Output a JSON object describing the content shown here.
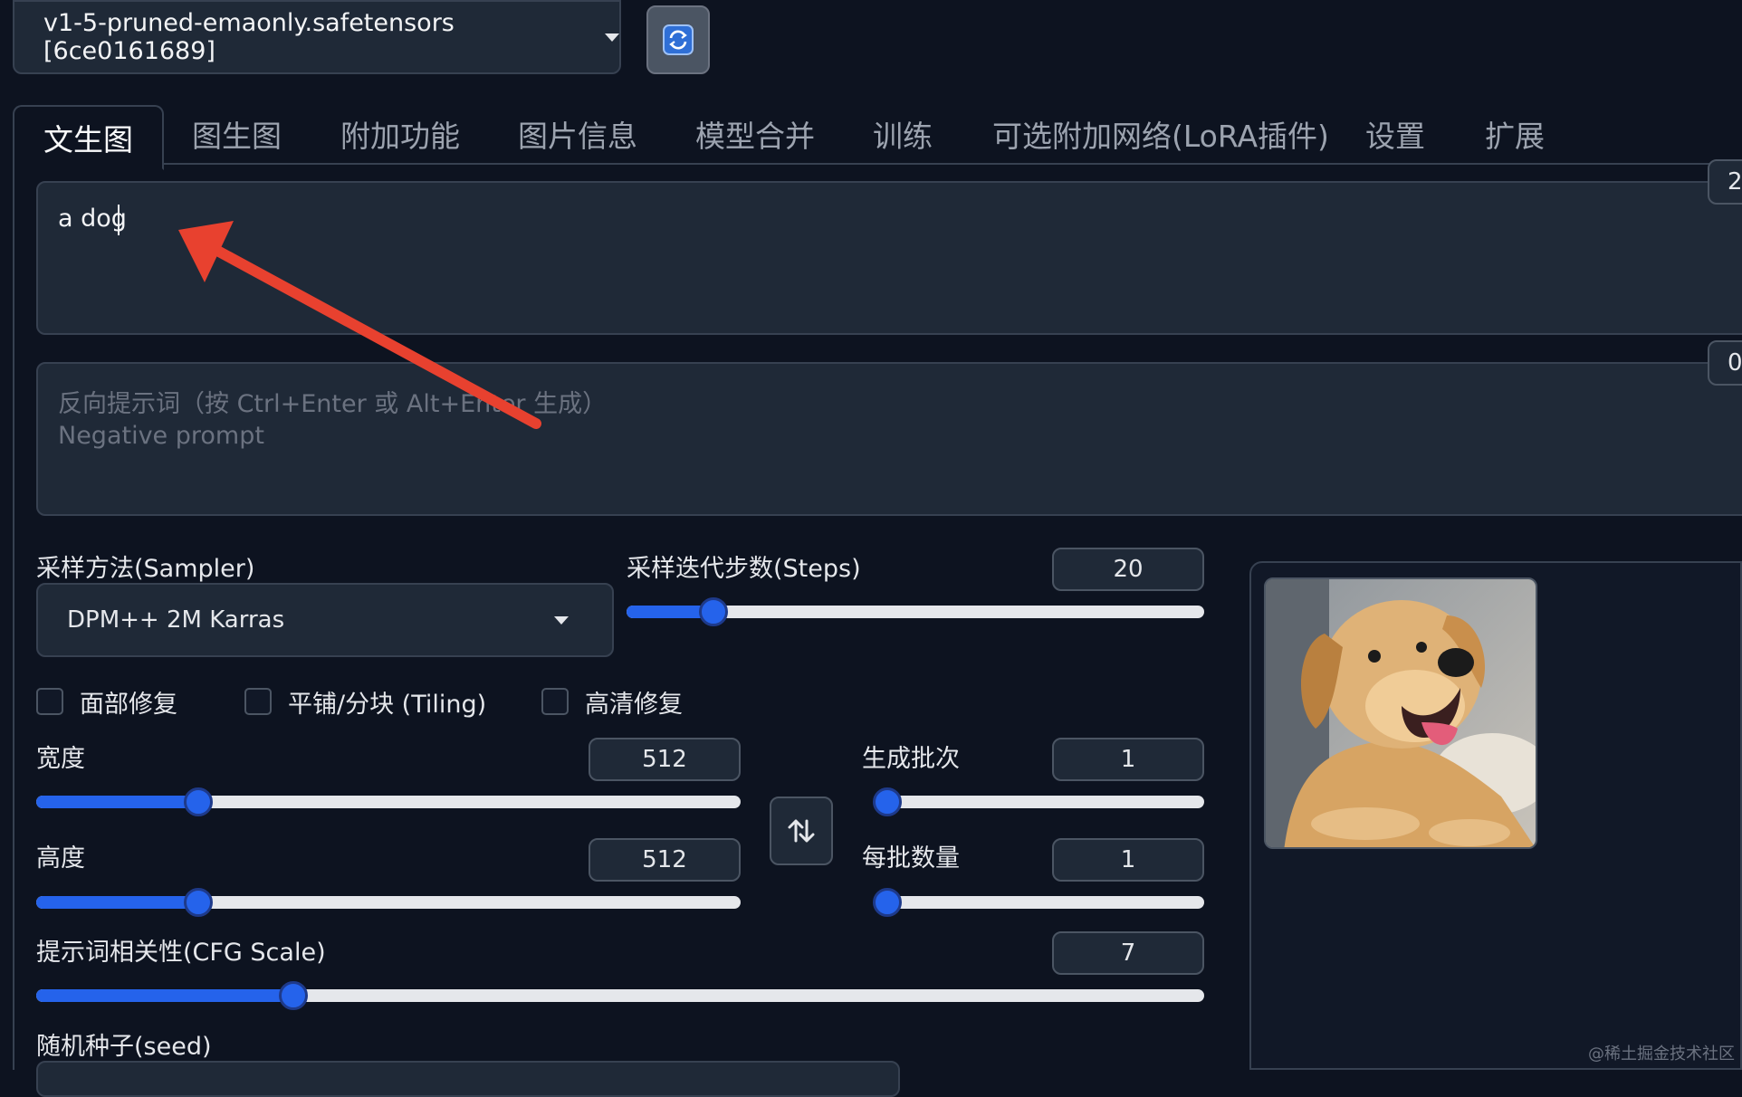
{
  "header": {
    "model": "v1-5-pruned-emaonly.safetensors [6ce0161689]",
    "refresh_icon": "refresh-icon"
  },
  "tabs": [
    {
      "label": "文生图",
      "active": true
    },
    {
      "label": "图生图"
    },
    {
      "label": "附加功能"
    },
    {
      "label": "图片信息"
    },
    {
      "label": "模型合并"
    },
    {
      "label": "训练"
    },
    {
      "label": "可选附加网络(LoRA插件)"
    },
    {
      "label": "设置"
    },
    {
      "label": "扩展"
    }
  ],
  "prompt": {
    "value": "a dog",
    "counter": "2"
  },
  "negative": {
    "placeholder_line1": "反向提示词（按 Ctrl+Enter 或 Alt+Enter 生成）",
    "placeholder_line2": "Negative prompt",
    "counter": "0"
  },
  "sampler": {
    "label": "采样方法(Sampler)",
    "value": "DPM++ 2M Karras"
  },
  "steps": {
    "label": "采样迭代步数(Steps)",
    "value": "20",
    "fraction": 0.15
  },
  "checkboxes": [
    {
      "label": "面部修复",
      "checked": false
    },
    {
      "label": "平铺/分块 (Tiling)",
      "checked": false
    },
    {
      "label": "高清修复",
      "checked": false
    }
  ],
  "width": {
    "label": "宽度",
    "value": "512",
    "fraction": 0.23
  },
  "height": {
    "label": "高度",
    "value": "512",
    "fraction": 0.23
  },
  "swap_icon": "swap-vertical-icon",
  "batch_count": {
    "label": "生成批次",
    "value": "1",
    "fraction": 0.0
  },
  "batch_size": {
    "label": "每批数量",
    "value": "1",
    "fraction": 0.0
  },
  "cfg": {
    "label": "提示词相关性(CFG Scale)",
    "value": "7",
    "fraction": 0.22
  },
  "seed": {
    "label": "随机种子(seed)"
  },
  "watermark": "@稀土掘金技术社区",
  "colors": {
    "accent": "#2563eb",
    "background": "#0d1320",
    "panel": "#1f2937",
    "arrow": "#e8412f"
  }
}
